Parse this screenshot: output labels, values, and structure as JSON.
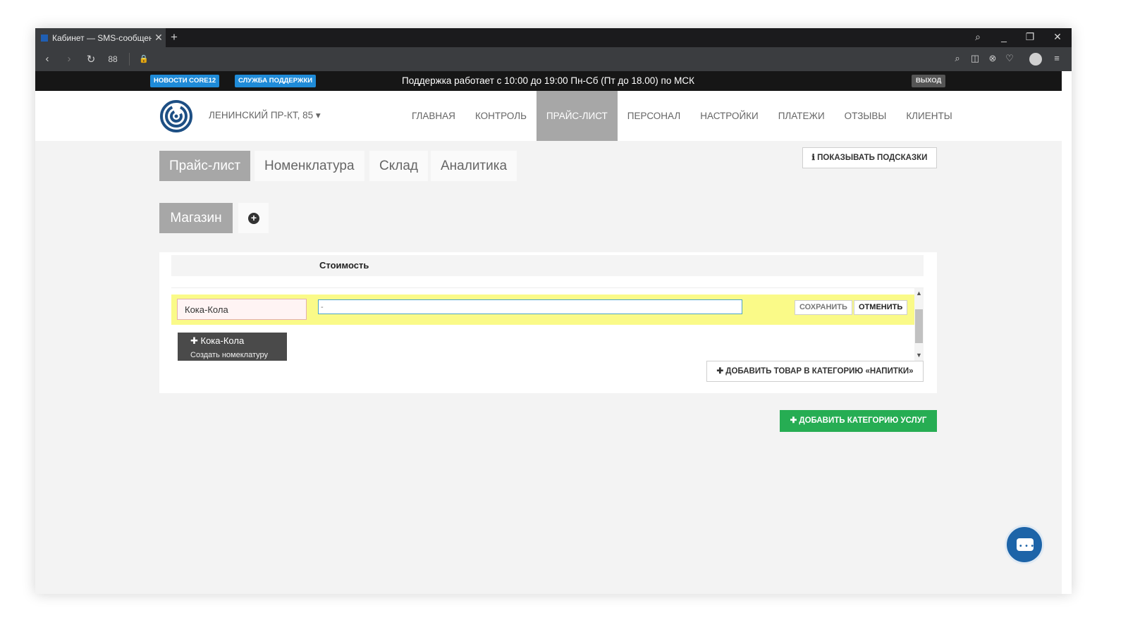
{
  "browser": {
    "tab_title": "Кабинет — SMS-сообщен",
    "close_glyph": "✕",
    "newtab_glyph": "+",
    "controls": {
      "search": "⌕",
      "minimize": "_",
      "restore": "❐",
      "close": "✕"
    },
    "nav": {
      "back": "‹",
      "forward": "›",
      "reload": "↻",
      "grid": "88",
      "lock": "🔒"
    },
    "right_icons": {
      "find": "⌕",
      "camera": "◫",
      "shield": "⊗",
      "heart": "♡",
      "menu": "≡"
    }
  },
  "sitebar": {
    "news_badge": "НОВОСТИ CORE12",
    "support_badge": "СЛУЖБА ПОДДЕРЖКИ",
    "support_hours": "Поддержка работает с 10:00 до 19:00 Пн-Сб (Пт до 18.00) по МСК",
    "logout": "ВЫХОД"
  },
  "header": {
    "location": "ЛЕНИНСКИЙ ПР-КТ, 85 ▾",
    "nav": [
      {
        "label": "ГЛАВНАЯ"
      },
      {
        "label": "КОНТРОЛЬ"
      },
      {
        "label": "ПРАЙС-ЛИСТ"
      },
      {
        "label": "ПЕРСОНАЛ"
      },
      {
        "label": "НАСТРОЙКИ"
      },
      {
        "label": "ПЛАТЕЖИ"
      },
      {
        "label": "ОТЗЫВЫ"
      },
      {
        "label": "КЛИЕНТЫ"
      }
    ]
  },
  "subtabs": [
    {
      "label": "Прайс-лист"
    },
    {
      "label": "Номенклатура"
    },
    {
      "label": "Склад"
    },
    {
      "label": "Аналитика"
    }
  ],
  "hints_button": "ℹ  ПОКАЗЫВАТЬ ПОДСКАЗКИ",
  "store_tab": "Магазин",
  "add_store_glyph": "+",
  "table": {
    "column_header": "Стоимость"
  },
  "edit_row": {
    "name_value": "Кока-Кола",
    "price_value": "-",
    "save": "СОХРАНИТЬ",
    "cancel": "ОТМЕНИТЬ"
  },
  "suggestion": {
    "name": "✚ Кока-Кола",
    "sub": "Создать номеклатуру"
  },
  "add_item_button": "✚  ДОБАВИТЬ ТОВАР В КАТЕГОРИЮ «НАПИТКИ»",
  "add_category_button": "✚  ДОБАВИТЬ КАТЕГОРИЮ УСЛУГ",
  "chat_dots": "• • •",
  "colors": {
    "accent_green": "#26ad53",
    "badge_blue": "#1f8bd8",
    "edit_row": "#fafa88",
    "active_tab": "#a7a7a7",
    "chat_blue": "#1d64a8"
  }
}
